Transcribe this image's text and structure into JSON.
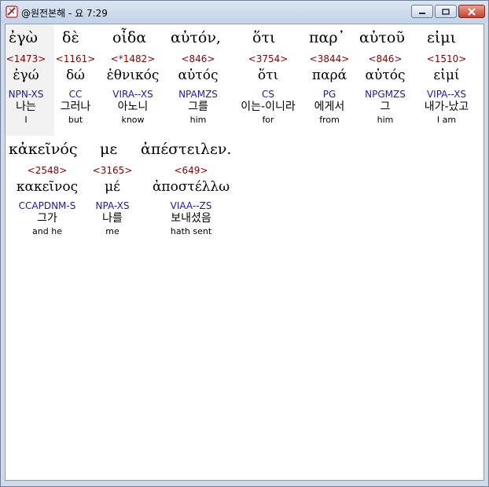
{
  "window": {
    "title": "@원전본해 - 요 7:29"
  },
  "row1": [
    {
      "greek": "ἐγὼ",
      "strong": "<1473>",
      "lemma": "ἐγώ",
      "morph": "NPN-XS",
      "korean": "나는",
      "english": "I"
    },
    {
      "greek": "δὲ",
      "strong": "<1161>",
      "lemma": "δώ",
      "morph": "CC",
      "korean": "그러나",
      "english": "but"
    },
    {
      "greek": "οἶδα",
      "strong": "<*1482>",
      "lemma": "ἐθνικός",
      "morph": "VIRA--XS",
      "korean": "아노니",
      "english": "know"
    },
    {
      "greek": "αὐτόν,",
      "strong": "<846>",
      "lemma": "αὐτός",
      "morph": "NPAMZS",
      "korean": "그를",
      "english": "him"
    },
    {
      "greek": "ὅτι",
      "strong": "<3754>",
      "lemma": "ὅτι",
      "morph": "CS",
      "korean": "이는-이니라",
      "english": "for"
    },
    {
      "greek": "παρ᾽",
      "strong": "<3844>",
      "lemma": "παρά",
      "morph": "PG",
      "korean": "에게서",
      "english": "from"
    },
    {
      "greek": "αὐτοῦ",
      "strong": "<846>",
      "lemma": "αὐτός",
      "morph": "NPGMZS",
      "korean": "그",
      "english": "him"
    },
    {
      "greek": "εἰμι",
      "strong": "<1510>",
      "lemma": "εἰμί",
      "morph": "VIPA--XS",
      "korean": "내가-났고",
      "english": "I am"
    }
  ],
  "row2": [
    {
      "greek": "κἀκεῖνός",
      "strong": "<2548>",
      "lemma": "κακεῖνος",
      "morph": "CCAPDNM-S",
      "korean": "그가",
      "english": "and he"
    },
    {
      "greek": "με",
      "strong": "<3165>",
      "lemma": "μέ",
      "morph": "NPA-XS",
      "korean": "나를",
      "english": "me"
    },
    {
      "greek": "ἀπέστειλεν.",
      "strong": "<649>",
      "lemma": "ἀποστέλλω",
      "morph": "VIAA--ZS",
      "korean": "보내셨음",
      "english": "hath sent"
    }
  ]
}
